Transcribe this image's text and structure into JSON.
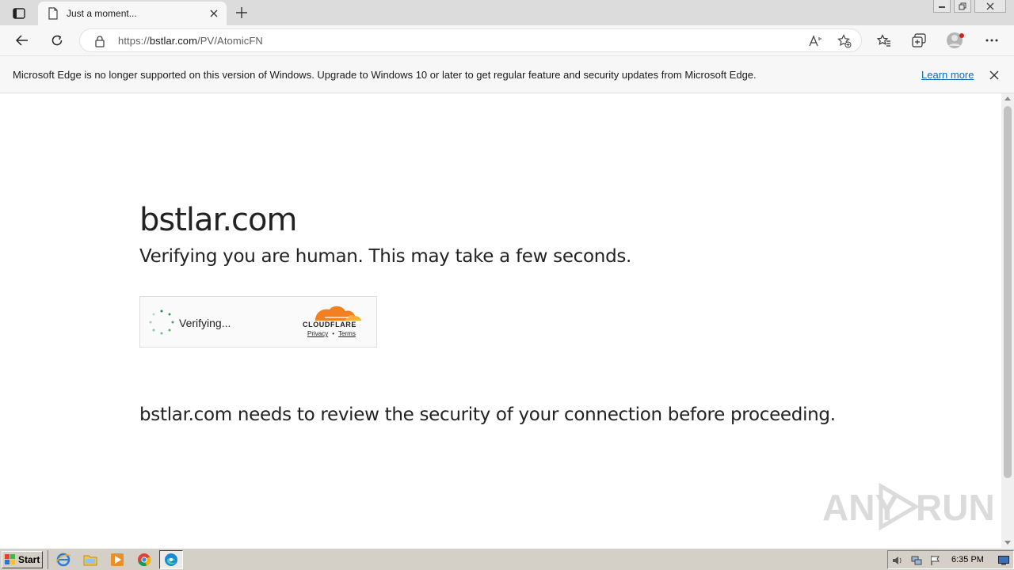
{
  "browser": {
    "tab": {
      "title": "Just a moment...",
      "favicon": "page-icon"
    },
    "address": {
      "scheme": "https://",
      "host": "bstlar.com",
      "path": "/PV/AtomicFN"
    },
    "infobar": {
      "message": "Microsoft Edge is no longer supported on this version of Windows. Upgrade to Windows 10 or later to get regular feature and security updates from Microsoft Edge.",
      "link": "Learn more"
    }
  },
  "page": {
    "site_title": "bstlar.com",
    "subtitle": "Verifying you are human. This may take a few seconds.",
    "widget": {
      "status": "Verifying...",
      "brand": "CLOUDFLARE",
      "privacy": "Privacy",
      "separator": "•",
      "terms": "Terms"
    },
    "review_text": "bstlar.com needs to review the security of your connection before proceeding."
  },
  "watermark": {
    "left": "ANY",
    "right": "RUN"
  },
  "taskbar": {
    "start_label": "Start",
    "clock": "6:35 PM"
  },
  "colors": {
    "accent": "#0f6cbd",
    "cloudflare_orange": "#f38020",
    "spinner_green": "#1e8c45"
  }
}
